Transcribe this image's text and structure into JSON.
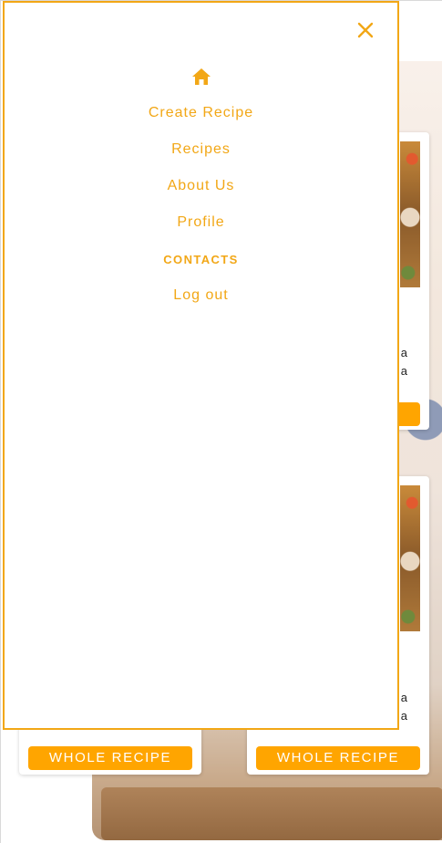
{
  "menu": {
    "home_icon": "home-icon",
    "close_icon": "close-icon",
    "items": [
      {
        "label": "Create Recipe"
      },
      {
        "label": "Recipes"
      },
      {
        "label": "About Us"
      },
      {
        "label": "Profile"
      },
      {
        "label": "CONTACTS"
      },
      {
        "label": "Log out"
      }
    ]
  },
  "cards": [
    {
      "text_lines": [
        "a",
        "a"
      ],
      "button_label": ""
    },
    {
      "text_lines": [
        "a",
        "a"
      ],
      "button_label": ""
    },
    {
      "text_lines": [],
      "button_label": "WHOLE RECIPE"
    },
    {
      "text_lines": [],
      "button_label": "WHOLE RECIPE"
    }
  ],
  "colors": {
    "accent": "#f2a716",
    "button": "#ffa500"
  }
}
